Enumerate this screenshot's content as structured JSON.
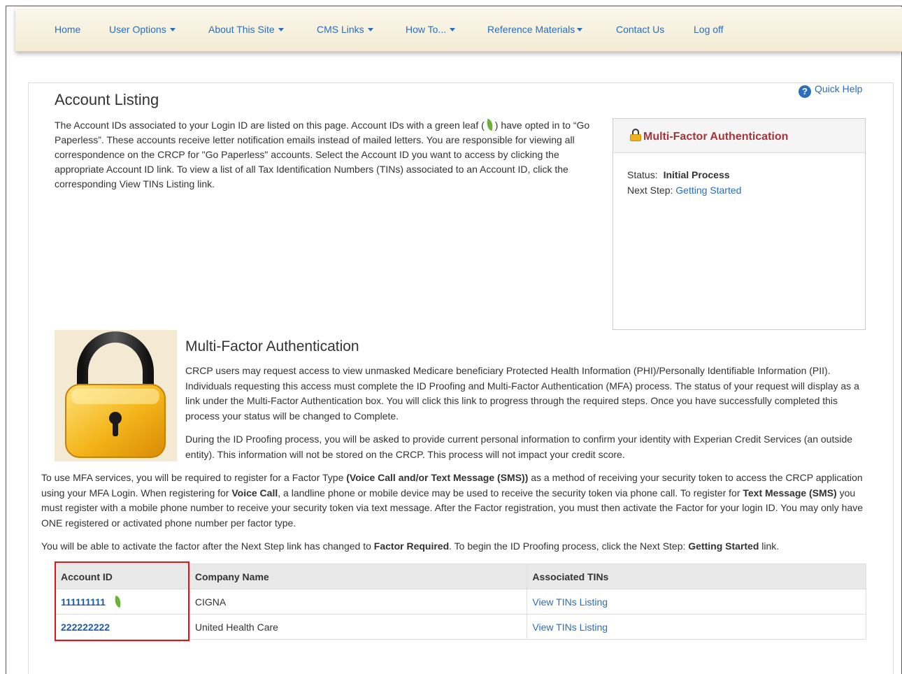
{
  "nav": {
    "items": [
      {
        "label": "Home",
        "dropdown": false
      },
      {
        "label": "User Options",
        "dropdown": true
      },
      {
        "label": "About This Site",
        "dropdown": true
      },
      {
        "label": "CMS Links",
        "dropdown": true
      },
      {
        "label": "How To...",
        "dropdown": true
      },
      {
        "label": "Reference Materials",
        "dropdown": true
      },
      {
        "label": "Contact Us",
        "dropdown": false
      },
      {
        "label": "Log off",
        "dropdown": false
      }
    ]
  },
  "page": {
    "title": "Account Listing",
    "quick_help": "Quick Help",
    "intro_before_leaf": "The Account IDs associated to your Login ID are listed on this page. Account IDs with a green leaf (",
    "intro_after_leaf": ") have opted in to “Go Paperless”. These accounts receive letter notification emails instead of mailed letters. You are responsible for viewing all correspondence on the CRCP for \"Go Paperless\" accounts. Select the Account ID you want to access by clicking the appropriate Account ID link. To view a list of all Tax Identification Numbers (TINs) associated to an Account ID, click the corresponding View TINs Listing link."
  },
  "mfa_box": {
    "title": "Multi-Factor Authentication",
    "status_label": "Status:",
    "status_value": "Initial Process",
    "next_step_label": "Next Step:",
    "next_step_link": "Getting Started"
  },
  "mfa_section": {
    "heading": "Multi-Factor Authentication",
    "para1": "CRCP users may request access to view unmasked Medicare beneficiary Protected Health Information (PHI)/Personally Identifiable Information (PII). Individuals requesting this access must complete the ID Proofing and Multi-Factor Authentication (MFA) process. The status of your request will display as a link under the Multi-Factor Authentication box. You will click this link to progress through the required steps. Once you have successfully completed this process your status will be changed to Complete.",
    "para2": "During the ID Proofing process, you will be asked to provide current personal information to confirm your identity with Experian Credit Services (an outside entity). This information will not be stored on the CRCP. This process will not impact your credit score.",
    "para3": {
      "t1": "To use MFA services, you will be required to register for a Factor Type ",
      "b1": "(Voice Call and/or Text Message (SMS))",
      "t2": " as a method of receiving your security token to access the CRCP application using your MFA Login. When registering for ",
      "b2": "Voice Call",
      "t3": ", a landline phone or mobile device may be used to receive the security token via phone call. To register for ",
      "b3": "Text Message (SMS)",
      "t4": " you must register with a mobile phone number to receive your security token via text message. After the Factor registration, you must then activate the Factor for your login ID. You may only have ONE registered or activated phone number per factor type."
    },
    "para4": {
      "t1": "You will be able to activate the factor after the Next Step link has changed to ",
      "b1": "Factor Required",
      "t2": ". To begin the ID Proofing process, click the Next Step: ",
      "b2": "Getting Started",
      "t3": " link."
    }
  },
  "table": {
    "headers": [
      "Account ID",
      "Company Name",
      "Associated TINs"
    ],
    "rows": [
      {
        "account_id": "111111111",
        "paperless": true,
        "company": "CIGNA",
        "tins_link": "View TINs Listing"
      },
      {
        "account_id": "222222222",
        "paperless": false,
        "company": "United Health Care",
        "tins_link": "View TINs Listing"
      }
    ]
  },
  "colors": {
    "link": "#2a6ebb",
    "mfa_title": "#a2363a",
    "highlight_border": "#e0151c",
    "leaf": "#6ab334",
    "nav_bg": "#f7f1e0"
  }
}
